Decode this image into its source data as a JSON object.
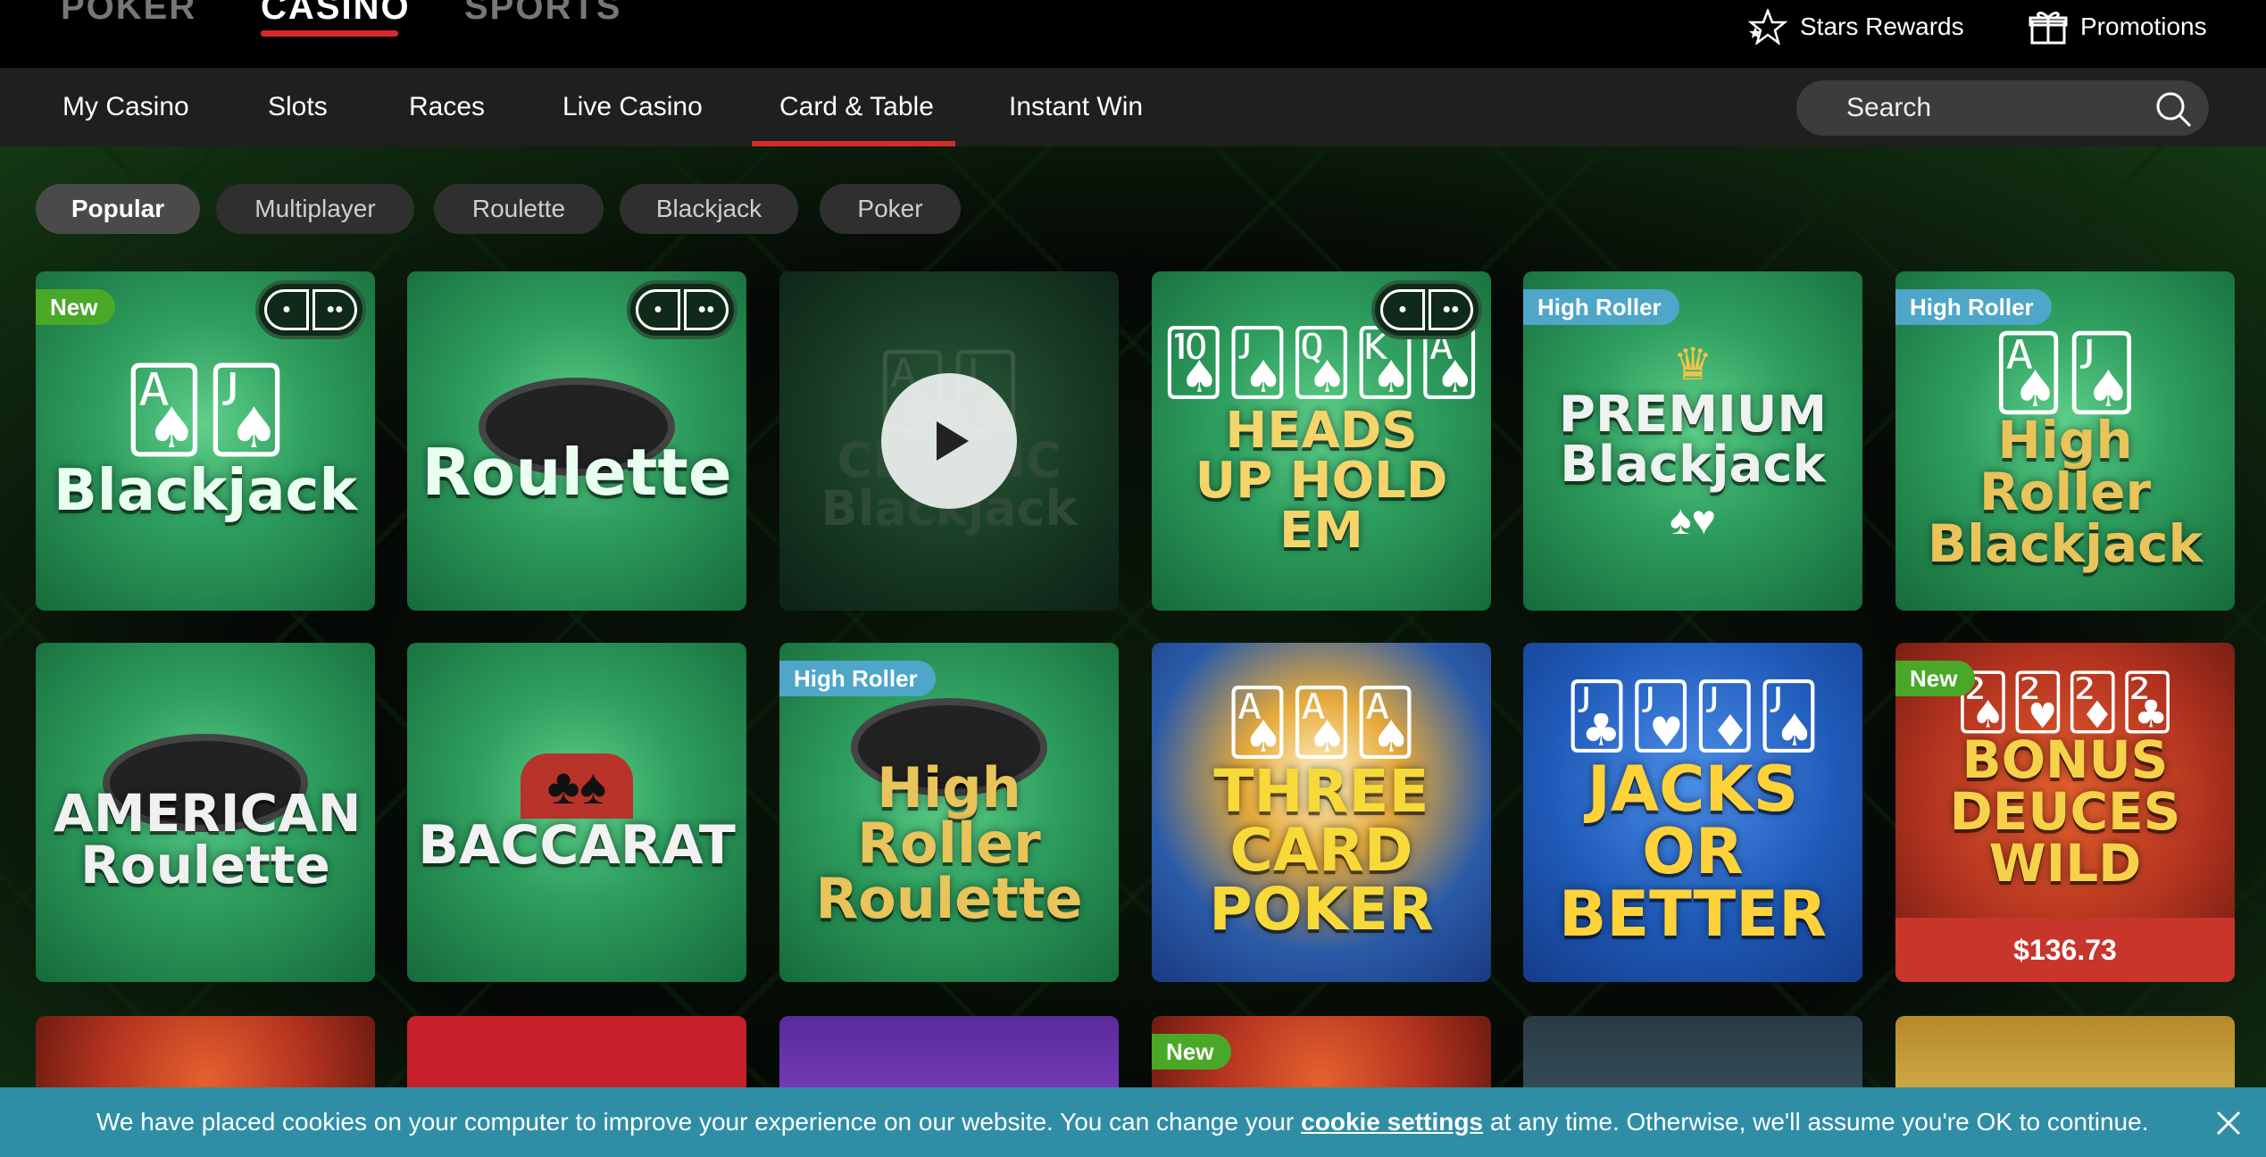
{
  "top_nav": {
    "products": [
      "POKER",
      "CASINO",
      "SPORTS"
    ],
    "active_product": "CASINO",
    "stars_rewards": "Stars Rewards",
    "promotions": "Promotions"
  },
  "sub_nav": {
    "items": [
      "My Casino",
      "Slots",
      "Races",
      "Live Casino",
      "Card & Table",
      "Instant Win"
    ],
    "active": "Card & Table",
    "search_placeholder": "Search"
  },
  "filters": {
    "chips": [
      "Popular",
      "Multiplayer",
      "Roulette",
      "Blackjack",
      "Poker"
    ],
    "active": "Popular"
  },
  "games": [
    {
      "title": "Blackjack",
      "badge": "New",
      "multiplayer": true
    },
    {
      "title": "Roulette",
      "badge": "",
      "multiplayer": true
    },
    {
      "title": "CLASSIC Blackjack",
      "badge": "",
      "multiplayer": false,
      "playing": true
    },
    {
      "title": "HEADS UP HOLD EM",
      "badge": "",
      "multiplayer": true
    },
    {
      "title": "PREMIUM Blackjack",
      "badge": "High Roller",
      "multiplayer": false
    },
    {
      "title": "High Roller Blackjack",
      "badge": "High Roller",
      "multiplayer": false
    },
    {
      "title": "AMERICAN Roulette",
      "badge": "",
      "multiplayer": false
    },
    {
      "title": "BACCARAT",
      "badge": "",
      "multiplayer": false
    },
    {
      "title": "High Roller Roulette",
      "badge": "High Roller",
      "multiplayer": false
    },
    {
      "title": "THREE CARD POKER",
      "badge": "",
      "multiplayer": false
    },
    {
      "title": "JACKS OR BETTER",
      "badge": "",
      "multiplayer": false
    },
    {
      "title": "BONUS DEUCES WILD",
      "badge": "New",
      "multiplayer": false,
      "jackpot": "$136.73"
    }
  ],
  "third_row_badges": [
    "",
    "",
    "",
    "New",
    "",
    ""
  ],
  "cookie": {
    "text_before": "We have placed cookies on your computer to improve your experience on our website. You can change your",
    "link": "cookie settings",
    "text_after": "at any time. Otherwise, we'll assume you're OK to continue."
  },
  "colors": {
    "accent_red": "#d52a2a",
    "badge_new": "#4aa828",
    "badge_high_roller": "#4ea6c8",
    "jackpot_bar": "#c7352b",
    "cookie_bar": "#2f8ea6"
  }
}
